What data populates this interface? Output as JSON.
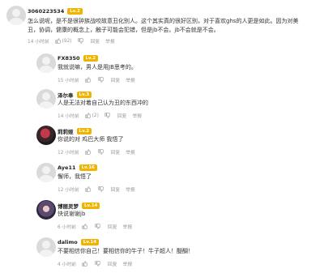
{
  "icons": {
    "like": "thumbs-up-icon",
    "dislike": "thumbs-down-icon"
  },
  "colors": {
    "level_badge": "#f0b400"
  },
  "main_comment": {
    "user": "3060223534",
    "level": "Lv.2",
    "text_lines": [
      "怎么说呢，是不是很钟族战咬故意丑化别人。这个其实真的很好区别，对于喜欢ghs的人更是如此。因为对美",
      "丑，协调，健康的概念上，触子可能会犯错，但是jb不会。jb不会就是不会。"
    ],
    "time": "14 小时前",
    "likes": "(92)",
    "reply_label": "回复",
    "report_label": "举报"
  },
  "replies": [
    {
      "user": "FX8350",
      "level": "Lv.2",
      "text": "我就说嘛，男人是用JB思考的。",
      "time": "15 小时前",
      "reply_label": "回复",
      "report_label": "举报"
    },
    {
      "user": "泽尔奉",
      "level": "Lv.3",
      "text": "人是无法对着自己认为丑的东西冲的",
      "time": "14 小时前",
      "likes": "(2)",
      "reply_label": "回复",
      "report_label": "举报"
    },
    {
      "user": "莉莉娅",
      "level": "Lv.2",
      "text": "你说的对 鸡巴大师 我悟了",
      "time": "12 小时前",
      "reply_label": "回复",
      "report_label": "举报"
    },
    {
      "user": "Aye11",
      "level": "Lv.16",
      "text": "懈师，我悟了",
      "time": "12 小时前",
      "reply_label": "回复",
      "report_label": "举报"
    },
    {
      "user": "博丽灵梦",
      "level": "Lv.14",
      "text": "快说谢谢jb",
      "time": "6 小时前",
      "reply_label": "回复",
      "report_label": "举报"
    },
    {
      "user": "dalimo",
      "level": "Lv.14",
      "text": "不要相信你自己！要相信你的牛子！牛子超人！醍醐！",
      "time": "4 小时前",
      "reply_label": "回复",
      "report_label": "举报"
    }
  ]
}
